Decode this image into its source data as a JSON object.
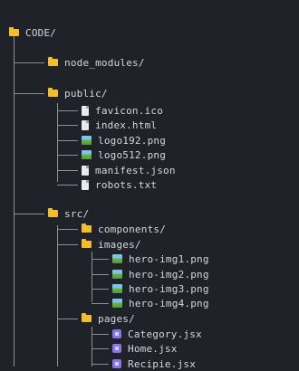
{
  "tree": [
    {
      "id": "code",
      "label": "CODE/",
      "type": "folder",
      "depth": 0
    },
    {
      "id": "node-modules",
      "label": "node_modules/",
      "type": "folder",
      "depth": 1
    },
    {
      "id": "public",
      "label": "public/",
      "type": "folder",
      "depth": 1
    },
    {
      "id": "favicon",
      "label": "favicon.ico",
      "type": "file",
      "depth": 2
    },
    {
      "id": "index-html",
      "label": "index.html",
      "type": "file",
      "depth": 2
    },
    {
      "id": "logo192",
      "label": "logo192.png",
      "type": "image",
      "depth": 2
    },
    {
      "id": "logo512",
      "label": "logo512.png",
      "type": "image",
      "depth": 2
    },
    {
      "id": "manifest",
      "label": "manifest.json",
      "type": "file",
      "depth": 2
    },
    {
      "id": "robots",
      "label": "robots.txt",
      "type": "file",
      "depth": 2
    },
    {
      "id": "src",
      "label": "src/",
      "type": "folder",
      "depth": 1
    },
    {
      "id": "components",
      "label": "components/",
      "type": "folder",
      "depth": 2
    },
    {
      "id": "images",
      "label": "images/",
      "type": "folder",
      "depth": 2
    },
    {
      "id": "hero-img1",
      "label": "hero-img1.png",
      "type": "image",
      "depth": 3
    },
    {
      "id": "hero-img2",
      "label": "hero-img2.png",
      "type": "image",
      "depth": 3
    },
    {
      "id": "hero-img3",
      "label": "hero-img3.png",
      "type": "image",
      "depth": 3
    },
    {
      "id": "hero-img4",
      "label": "hero-img4.png",
      "type": "image",
      "depth": 3
    },
    {
      "id": "pages",
      "label": "pages/",
      "type": "folder",
      "depth": 2
    },
    {
      "id": "category-jsx",
      "label": "Category.jsx",
      "type": "jsx",
      "depth": 3
    },
    {
      "id": "home-jsx",
      "label": "Home.jsx",
      "type": "jsx",
      "depth": 3
    },
    {
      "id": "recipie-jsx",
      "label": "Recipie.jsx",
      "type": "jsx",
      "depth": 3
    }
  ],
  "colors": {
    "background": "#1f2229",
    "text": "#d3d7de",
    "folder": "#f0be2e",
    "jsx": "#8b74e6",
    "line": "#8a8f99"
  }
}
